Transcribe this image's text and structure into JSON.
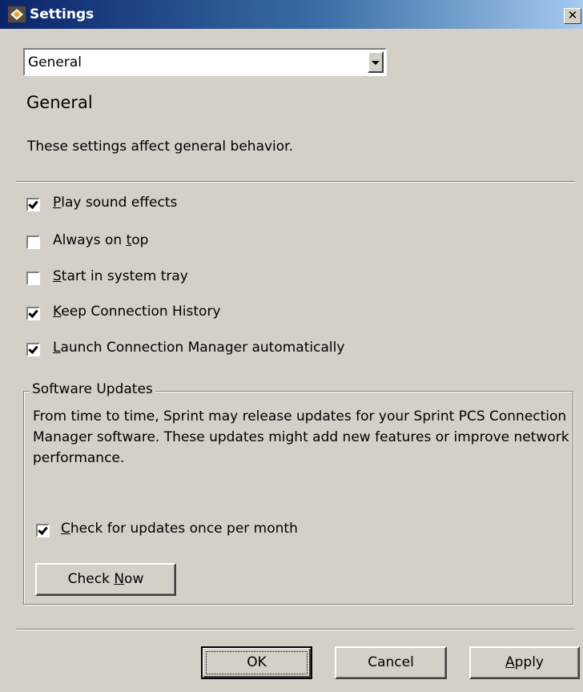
{
  "window": {
    "title": "Settings",
    "close_label": "✕"
  },
  "category_select": {
    "value": "General"
  },
  "page": {
    "heading": "General",
    "description": "These settings affect general behavior."
  },
  "options": [
    {
      "pre": "",
      "mn": "P",
      "post": "lay sound effects",
      "checked": true
    },
    {
      "pre": "Always on ",
      "mn": "t",
      "post": "op",
      "checked": false
    },
    {
      "pre": "",
      "mn": "S",
      "post": "tart in system tray",
      "checked": false
    },
    {
      "pre": "",
      "mn": "K",
      "post": "eep Connection History",
      "checked": true
    },
    {
      "pre": "",
      "mn": "L",
      "post": "aunch Connection Manager automatically",
      "checked": true
    }
  ],
  "software_updates": {
    "legend": "Software Updates",
    "text": "From time to time, Sprint may release updates for your Sprint PCS Connection Manager software.  These updates might add new features or improve network performance.",
    "check": {
      "pre": "",
      "mn": "C",
      "post": "heck for updates once per month",
      "checked": true
    },
    "check_now": {
      "pre": "Check ",
      "mn": "N",
      "post": "ow"
    }
  },
  "buttons": {
    "ok": "OK",
    "cancel": "Cancel",
    "apply": {
      "pre": "",
      "mn": "A",
      "post": "pply"
    }
  },
  "colors": {
    "dialog_bg": "#d4d0c8",
    "titlebar_start": "#0a246a",
    "titlebar_end": "#a6caf0"
  },
  "icons": {
    "app": "sprint-app-icon",
    "close": "close-icon",
    "dropdown": "chevron-down-icon"
  }
}
